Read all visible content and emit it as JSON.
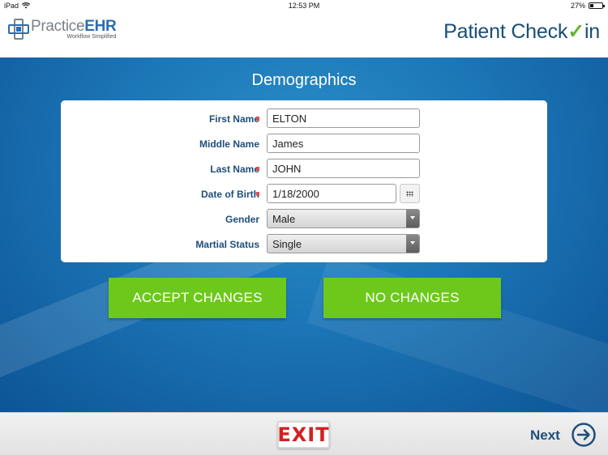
{
  "status_bar": {
    "device": "iPad",
    "time": "12:53 PM",
    "battery": "27%",
    "battery_level": 0.27
  },
  "header": {
    "logo_part1": "Practice",
    "logo_part2": "EHR",
    "logo_tagline": "Workflow Simplified",
    "brand_part1": "Patient Check",
    "brand_check": "✓",
    "brand_part2": "in"
  },
  "page_title": "Demographics",
  "form": {
    "first_name": {
      "label": "First Name",
      "value": "ELTON",
      "required": true
    },
    "middle_name": {
      "label": "Middle Name",
      "value": "James",
      "required": false
    },
    "last_name": {
      "label": "Last Name",
      "value": "JOHN",
      "required": true
    },
    "date_of_birth": {
      "label": "Date of Birth",
      "value": "1/18/2000",
      "required": true
    },
    "gender": {
      "label": "Gender",
      "value": "Male"
    },
    "marital_status": {
      "label": "Martial Status",
      "value": "Single"
    }
  },
  "buttons": {
    "accept": "ACCEPT CHANGES",
    "no_changes": "NO CHANGES"
  },
  "footer": {
    "exit": "EXIT",
    "next": "Next"
  },
  "colors": {
    "primary_blue": "#1c76b7",
    "button_green": "#6cc91b",
    "label_navy": "#1e4d7a",
    "required_red": "#e34d4d"
  }
}
